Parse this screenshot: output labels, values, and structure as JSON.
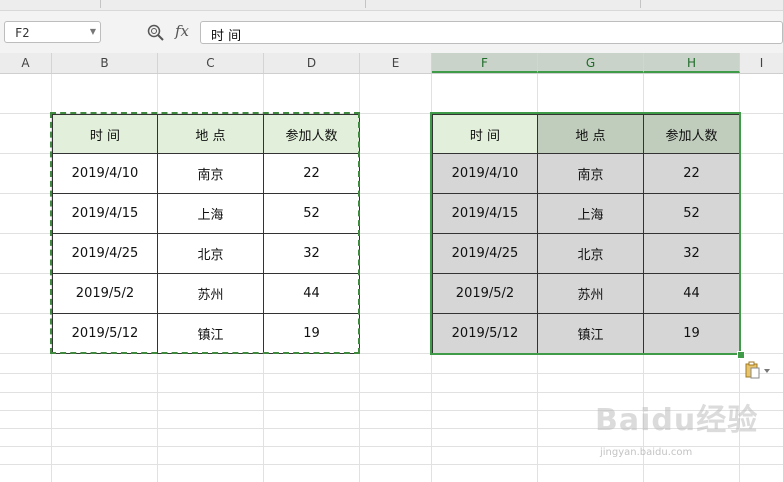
{
  "name_box": {
    "value": "F2"
  },
  "formula_bar": {
    "fx_label": "fx",
    "value": "时 间"
  },
  "columns": [
    "A",
    "B",
    "C",
    "D",
    "E",
    "F",
    "G",
    "H",
    "I"
  ],
  "selected_columns": [
    "F",
    "G",
    "H"
  ],
  "source_table": {
    "headers": [
      "时 间",
      "地 点",
      "参加人数"
    ],
    "rows": [
      [
        "2019/4/10",
        "南京",
        "22"
      ],
      [
        "2019/4/15",
        "上海",
        "52"
      ],
      [
        "2019/4/25",
        "北京",
        "32"
      ],
      [
        "2019/5/2",
        "苏州",
        "44"
      ],
      [
        "2019/5/12",
        "镇江",
        "19"
      ]
    ]
  },
  "pasted_table": {
    "headers": [
      "时 间",
      "地 点",
      "参加人数"
    ],
    "rows": [
      [
        "2019/4/10",
        "南京",
        "22"
      ],
      [
        "2019/4/15",
        "上海",
        "52"
      ],
      [
        "2019/4/25",
        "北京",
        "32"
      ],
      [
        "2019/5/2",
        "苏州",
        "44"
      ],
      [
        "2019/5/12",
        "镇江",
        "19"
      ]
    ]
  },
  "watermark": {
    "logo": "Baidu经验",
    "url": "jingyan.baidu.com"
  },
  "colors": {
    "selection_green": "#3f9b48",
    "header_fill": "#e2efda",
    "pasted_fill": "#d6d6d6"
  },
  "icons": {
    "zoom": "magnifier-icon",
    "paste_options": "clipboard-icon"
  }
}
